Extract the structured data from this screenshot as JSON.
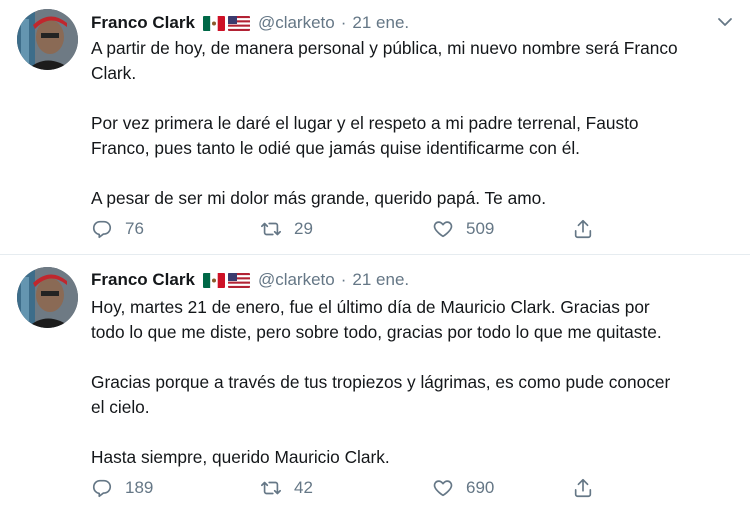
{
  "tweets": [
    {
      "name": "Franco Clark",
      "handle": "@clarketo",
      "separator": "·",
      "date": "21 ene.",
      "text": "A partir de hoy, de manera personal y pública, mi nuevo nombre será Franco\nClark.\n\nPor vez primera le daré el lugar y el respeto a mi padre terrenal, Fausto\nFranco, pues tanto le odié que jamás quise identificarme con él.\n\nA pesar de ser mi dolor más grande, querido papá. Te amo.",
      "replies": "76",
      "retweets": "29",
      "likes": "509"
    },
    {
      "name": "Franco Clark",
      "handle": "@clarketo",
      "separator": "·",
      "date": "21 ene.",
      "text": "Hoy, martes 21 de enero, fue el último día de Mauricio Clark. Gracias por\ntodo lo que me diste, pero sobre todo, gracias por todo lo que me quitaste.\n\nGracias porque a través de tus tropiezos y lágrimas, es como pude conocer\nel cielo.\n\nHasta siempre, querido Mauricio Clark.",
      "replies": "189",
      "retweets": "42",
      "likes": "690"
    }
  ],
  "icons": {
    "flags": [
      "mexico-flag-icon",
      "usa-flag-icon"
    ],
    "actions": [
      "reply-icon",
      "retweet-icon",
      "like-icon",
      "share-icon"
    ],
    "menu": "chevron-down-icon"
  },
  "colors": {
    "text": "#14171a",
    "muted": "#657786",
    "divider": "#e6ecf0"
  }
}
